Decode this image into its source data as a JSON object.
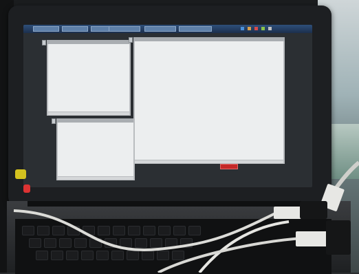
{
  "photo": {
    "subject": "laptop-with-usb-cables",
    "colors": {
      "screen_window": "#eceeef",
      "taskbar": "#2e4f7a",
      "red_button": "#c42828",
      "cable": "#e7e7e4"
    },
    "screen": {
      "windows": [
        "top-left-window",
        "bottom-left-window",
        "large-right-window"
      ],
      "taskbar_buttons": 6
    }
  }
}
